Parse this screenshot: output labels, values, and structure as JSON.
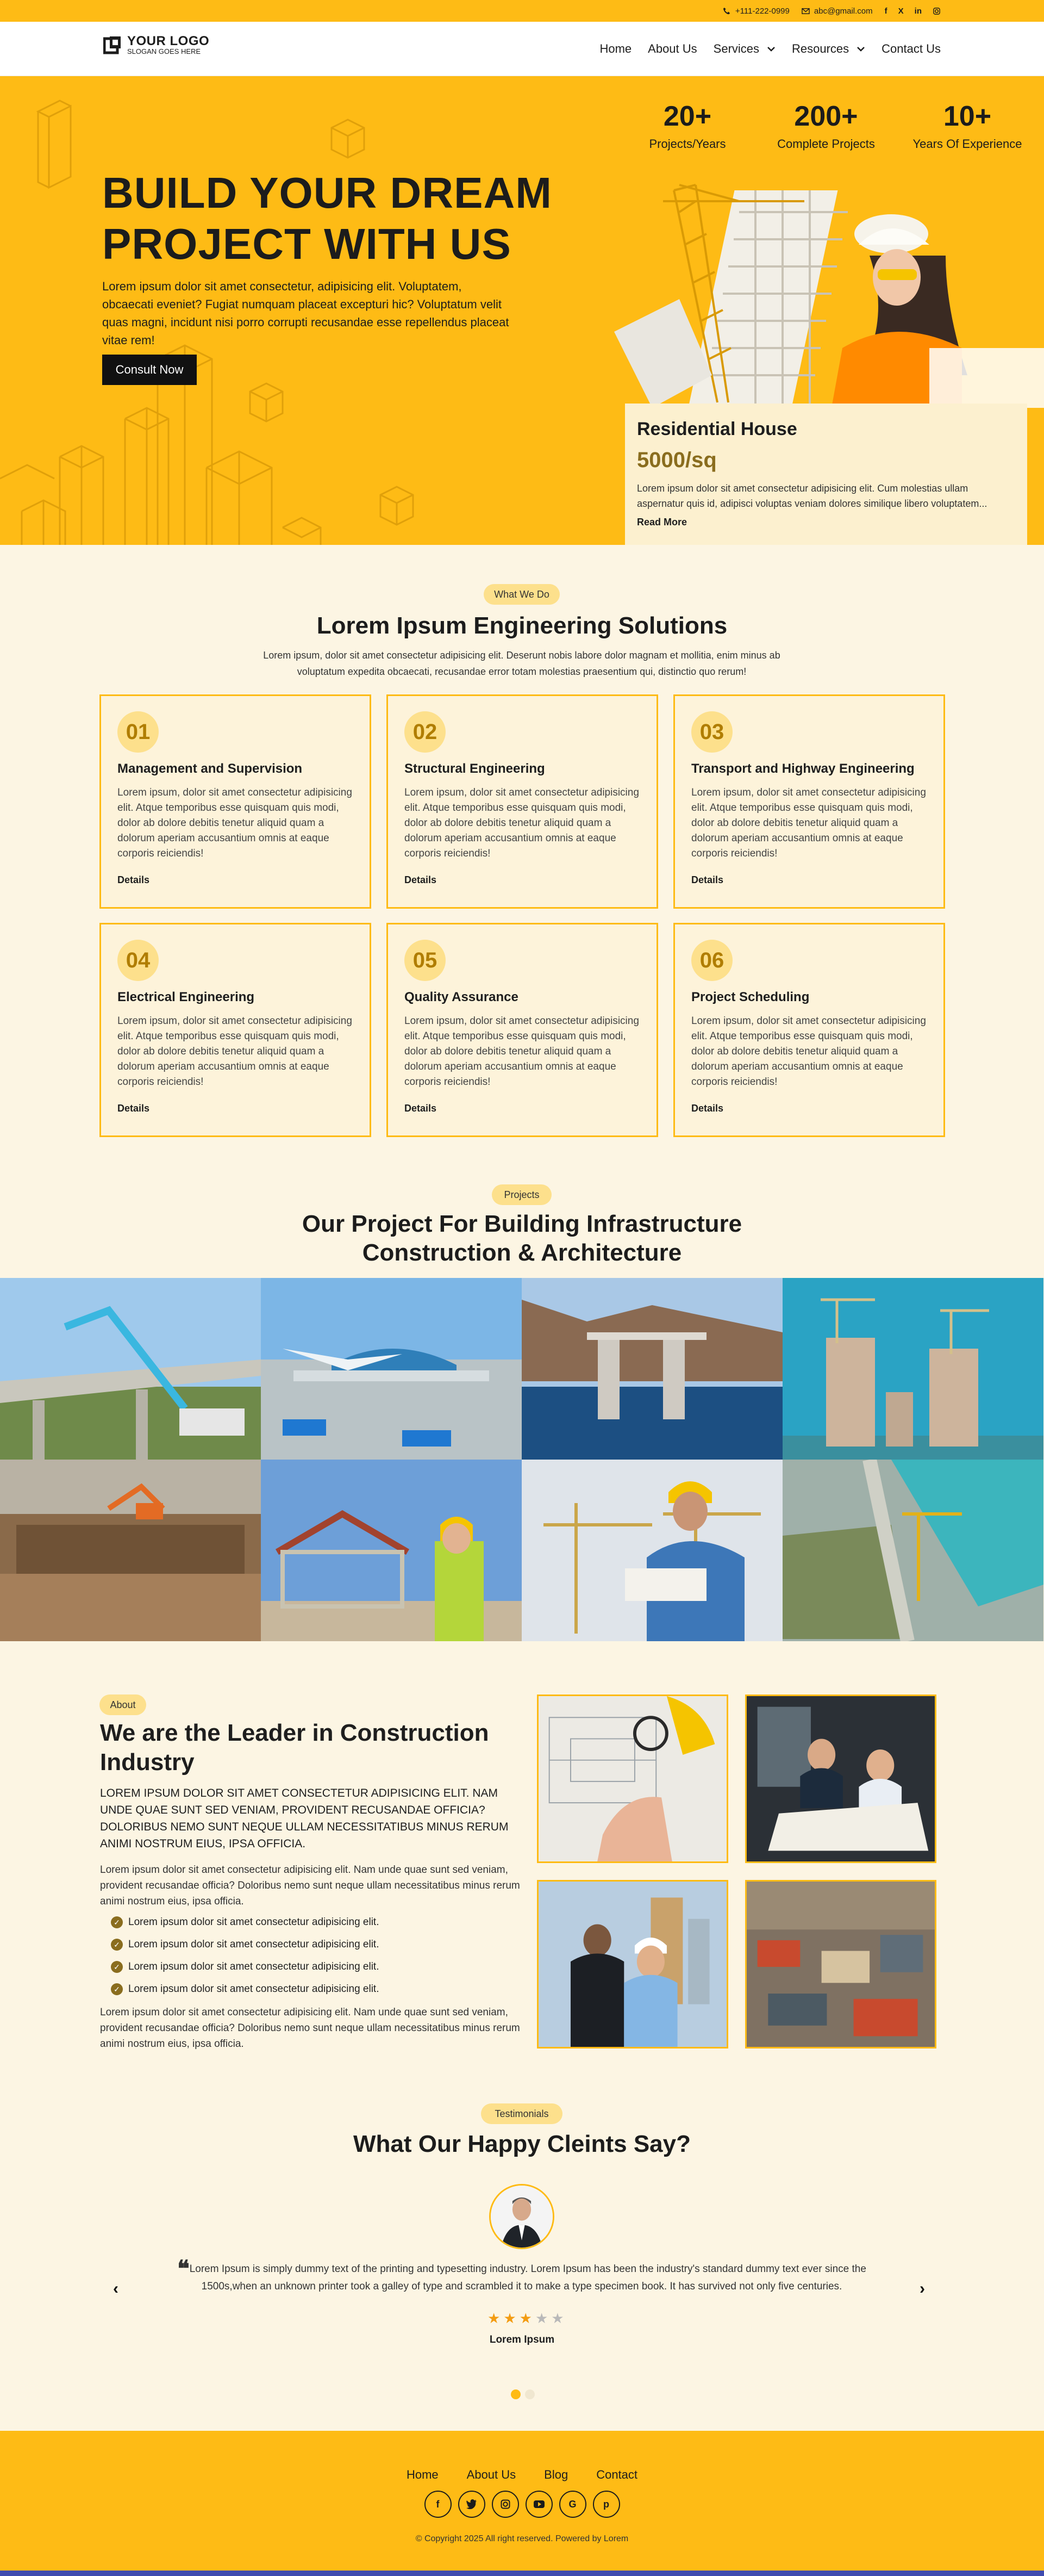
{
  "topbar": {
    "phone": "+111-222-0999",
    "email": "abc@gmail.com",
    "social": [
      "f",
      "X",
      "in",
      "ig"
    ]
  },
  "header": {
    "logo_title": "YOUR LOGO",
    "logo_slogan": "SLOGAN GOES HERE",
    "nav": [
      "Home",
      "About Us",
      "Services",
      "Resources",
      "Contact Us"
    ]
  },
  "hero": {
    "title_line1": "BUILD YOUR DREAM",
    "title_line2": "PROJECT WITH US",
    "text": "Lorem ipsum dolor sit amet consectetur, adipisicing elit. Voluptatem, obcaecati eveniet? Fugiat numquam placeat excepturi hic? Voluptatum velit quas magni, incidunt nisi porro corrupti recusandae esse repellendus placeat vitae rem!",
    "cta": "Consult Now",
    "stats": [
      {
        "num": "20+",
        "label": "Projects/Years"
      },
      {
        "num": "200+",
        "label": "Complete Projects"
      },
      {
        "num": "10+",
        "label": "Years Of Experience"
      }
    ],
    "card": {
      "title": "Residential House",
      "price": "5000/sq",
      "desc": "Lorem ipsum dolor sit amet consectetur adipisicing elit. Cum molestias ullam aspernatur quis id, adipisci voluptas veniam dolores similique libero voluptatem...",
      "link": "Read More"
    }
  },
  "services": {
    "pill": "What We Do",
    "title": "Lorem Ipsum Engineering Solutions",
    "subtitle": "Lorem ipsum, dolor sit amet consectetur adipisicing elit. Deserunt nobis labore dolor magnam et mollitia, enim minus ab voluptatum expedita obcaecati, recusandae error totam molestias praesentium qui, distinctio quo rerum!",
    "items": [
      {
        "num": "01",
        "title": "Management and Supervision",
        "desc": "Lorem ipsum, dolor sit amet consectetur adipisicing elit. Atque temporibus esse quisquam quis modi, dolor ab dolore debitis tenetur aliquid quam a dolorum aperiam accusantium omnis at eaque corporis reiciendis!",
        "link": "Details"
      },
      {
        "num": "02",
        "title": "Structural Engineering",
        "desc": "Lorem ipsum, dolor sit amet consectetur adipisicing elit. Atque temporibus esse quisquam quis modi, dolor ab dolore debitis tenetur aliquid quam a dolorum aperiam accusantium omnis at eaque corporis reiciendis!",
        "link": "Details"
      },
      {
        "num": "03",
        "title": "Transport and Highway Engineering",
        "desc": "Lorem ipsum, dolor sit amet consectetur adipisicing elit. Atque temporibus esse quisquam quis modi, dolor ab dolore debitis tenetur aliquid quam a dolorum aperiam accusantium omnis at eaque corporis reiciendis!",
        "link": "Details"
      },
      {
        "num": "04",
        "title": "Electrical Engineering",
        "desc": "Lorem ipsum, dolor sit amet consectetur adipisicing elit. Atque temporibus esse quisquam quis modi, dolor ab dolore debitis tenetur aliquid quam a dolorum aperiam accusantium omnis at eaque corporis reiciendis!",
        "link": "Details"
      },
      {
        "num": "05",
        "title": "Quality Assurance",
        "desc": "Lorem ipsum, dolor sit amet consectetur adipisicing elit. Atque temporibus esse quisquam quis modi, dolor ab dolore debitis tenetur aliquid quam a dolorum aperiam accusantium omnis at eaque corporis reiciendis!",
        "link": "Details"
      },
      {
        "num": "06",
        "title": "Project Scheduling",
        "desc": "Lorem ipsum, dolor sit amet consectetur adipisicing elit. Atque temporibus esse quisquam quis modi, dolor ab dolore debitis tenetur aliquid quam a dolorum aperiam accusantium omnis at eaque corporis reiciendis!",
        "link": "Details"
      }
    ]
  },
  "projects": {
    "pill": "Projects",
    "title_line1": "Our Project For Building Infrastructure",
    "title_line2": "Construction & Architecture"
  },
  "about": {
    "pill": "About",
    "title": "We are the Leader in Construction Industry",
    "caps": "LOREM IPSUM DOLOR SIT AMET CONSECTETUR ADIPISICING ELIT. NAM UNDE QUAE SUNT SED VENIAM, PROVIDENT RECUSANDAE OFFICIA? DOLORIBUS NEMO SUNT NEQUE ULLAM NECESSITATIBUS MINUS RERUM ANIMI NOSTRUM EIUS, IPSA OFFICIA.",
    "para1": "Lorem ipsum dolor sit amet consectetur adipisicing elit. Nam unde quae sunt sed veniam, provident recusandae officia? Doloribus nemo sunt neque ullam necessitatibus minus rerum animi nostrum eius, ipsa officia.",
    "checks": [
      "Lorem ipsum dolor sit amet consectetur adipisicing elit.",
      "Lorem ipsum dolor sit amet consectetur adipisicing elit.",
      "Lorem ipsum dolor sit amet consectetur adipisicing elit.",
      "Lorem ipsum dolor sit amet consectetur adipisicing elit."
    ],
    "para2": "Lorem ipsum dolor sit amet consectetur adipisicing elit. Nam unde quae sunt sed veniam, provident recusandae officia? Doloribus nemo sunt neque ullam necessitatibus minus rerum animi nostrum eius, ipsa officia."
  },
  "testimonials": {
    "pill": "Testimonials",
    "title": "What Our Happy Cleints Say?",
    "quote": "Lorem Ipsum is simply dummy text of the printing and typesetting industry. Lorem Ipsum has been the industry's standard dummy text ever since the 1500s,when an unknown printer took a galley of type and scrambled it to make a type specimen book. It has survived not only five centuries.",
    "rating": 3,
    "rating_max": 5,
    "name": "Lorem Ipsum",
    "prev": "‹",
    "next": "›"
  },
  "footer": {
    "nav": [
      "Home",
      "About Us",
      "Blog",
      "Contact"
    ],
    "social": [
      "f",
      "t",
      "ig",
      "yt",
      "G",
      "p"
    ],
    "copyright": "© Copyright 2025 All right reserved. Powered by Lorem"
  },
  "colors": {
    "accent": "#febb15",
    "cream": "#fcf5e3",
    "dark": "#111111",
    "brown": "#8a6d1e"
  }
}
